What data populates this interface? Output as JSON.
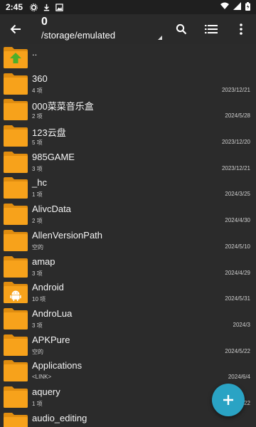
{
  "status": {
    "time": "2:45"
  },
  "toolbar": {
    "count": "0",
    "path": "/storage/emulated"
  },
  "files": [
    {
      "name": "..",
      "count": "",
      "date": "",
      "kind": "up"
    },
    {
      "name": "360",
      "count": "4 项",
      "date": "2023/12/21",
      "kind": "folder"
    },
    {
      "name": "000菜菜音乐盒",
      "count": "2 项",
      "date": "2024/5/28",
      "kind": "folder"
    },
    {
      "name": "123云盘",
      "count": "5 项",
      "date": "2023/12/20",
      "kind": "folder"
    },
    {
      "name": "985GAME",
      "count": "3 项",
      "date": "2023/12/21",
      "kind": "folder"
    },
    {
      "name": "_hc",
      "count": "1 项",
      "date": "2024/3/25",
      "kind": "folder"
    },
    {
      "name": "AlivcData",
      "count": "2 项",
      "date": "2024/4/30",
      "kind": "folder"
    },
    {
      "name": "AllenVersionPath",
      "count": "空的",
      "date": "2024/5/10",
      "kind": "folder"
    },
    {
      "name": "amap",
      "count": "3 项",
      "date": "2024/4/29",
      "kind": "folder"
    },
    {
      "name": "Android",
      "count": "10 项",
      "date": "2024/5/31",
      "kind": "android"
    },
    {
      "name": "AndroLua",
      "count": "3 项",
      "date": "2024/3",
      "kind": "folder"
    },
    {
      "name": "APKPure",
      "count": "空的",
      "date": "2024/5/22",
      "kind": "folder"
    },
    {
      "name": "Applications",
      "count": "<LINK>",
      "date": "2024/6/4",
      "kind": "folder"
    },
    {
      "name": "aquery",
      "count": "1 项",
      "date": "2024/5/22",
      "kind": "folder"
    },
    {
      "name": "audio_editing",
      "count": "",
      "date": "",
      "kind": "folder"
    }
  ],
  "colors": {
    "folder": "#f7a21b",
    "folder_dark": "#e08d10",
    "fab": "#2aa3c4",
    "up_arrow": "#4caf2a"
  },
  "icons": {
    "fab": "plus-icon",
    "back": "arrow-back-icon",
    "search": "search-icon",
    "view": "list-view-icon",
    "more": "more-vert-icon"
  }
}
